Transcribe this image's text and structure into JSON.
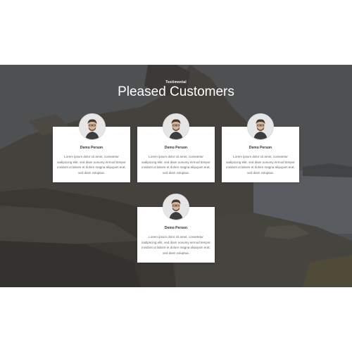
{
  "section": {
    "eyebrow": "Testimonial",
    "title": "Pleased Customers"
  },
  "testimonials": [
    {
      "name": "Demo Person",
      "text": "Lorem ipsum dolor sit amet, consetetur sadipscing elitr, sed diam nonumy eirmod tempor invidunt ut labore et dolore magna aliquyam erat, sed diam voluptua.",
      "avatar_icon": "person-avatar-icon"
    },
    {
      "name": "Demo Person",
      "text": "Lorem ipsum dolor sit amet, consetetur sadipscing elitr, sed diam nonumy eirmod tempor invidunt ut labore et dolore magna aliquyam erat, sed diam voluptua.",
      "avatar_icon": "person-avatar-icon"
    },
    {
      "name": "Demo Person",
      "text": "Lorem ipsum dolor sit amet, consetetur sadipscing elitr, sed diam nonumy eirmod tempor invidunt ut labore et dolore magna aliquyam erat, sed diam voluptua.",
      "avatar_icon": "person-avatar-icon"
    },
    {
      "name": "Demo Person",
      "text": "Lorem ipsum dolor sit amet, consetetur sadipscing elitr, sed diam nonumy eirmod tempor invidunt ut labore et dolore magna aliquyam erat, sed diam voluptua.",
      "avatar_icon": "person-avatar-icon"
    }
  ],
  "colors": {
    "card_bg": "#ffffff",
    "heading_text": "#ffffff",
    "body_text": "#666666",
    "name_text": "#333333"
  }
}
